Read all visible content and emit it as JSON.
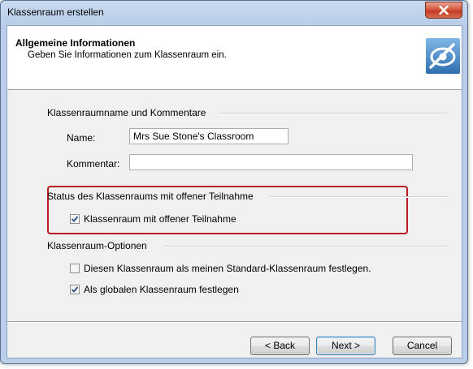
{
  "window": {
    "title": "Klassenraum erstellen"
  },
  "header": {
    "title": "Allgemeine Informationen",
    "subtitle": "Geben Sie Informationen zum Klassenraum ein."
  },
  "group_name": {
    "title": "Klassenraumname und Kommentare",
    "name_label": "Name:",
    "name_value": "Mrs Sue Stone's Classroom",
    "comment_label": "Kommentar:",
    "comment_value": ""
  },
  "group_status": {
    "title": "Status des Klassenraums mit offener Teilnahme",
    "checkbox_label": "Klassenraum mit offener Teilnahme",
    "checked": true
  },
  "group_options": {
    "title": "Klassenraum-Optionen",
    "default_label": "Diesen Klassenraum als meinen Standard-Klassenraum festlegen.",
    "default_checked": false,
    "global_label": "Als globalen Klassenraum festlegen",
    "global_checked": true
  },
  "buttons": {
    "back": "< Back",
    "next": "Next >",
    "cancel": "Cancel"
  },
  "colors": {
    "highlight": "#b81c22",
    "close_button": "#c23a22"
  }
}
